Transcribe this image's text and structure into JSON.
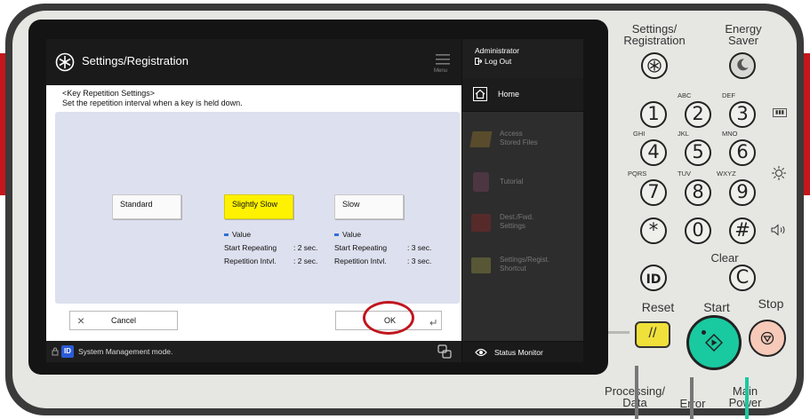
{
  "screen": {
    "title": "Settings/Registration",
    "menu_label": "Menu",
    "heading_line1": "<Key Repetition Settings>",
    "heading_line2": "Set the repetition interval when a key is held down.",
    "options": [
      {
        "label": "Standard",
        "selected": false
      },
      {
        "label": "Slightly Slow",
        "selected": true
      },
      {
        "label": "Slow",
        "selected": false
      }
    ],
    "value_blocks": [
      {
        "heading": "Value",
        "start_label": "Start Repeating",
        "start_value": ": 2  sec.",
        "interval_label": "Repetition Intvl.",
        "interval_value": ": 2  sec."
      },
      {
        "heading": "Value",
        "start_label": "Start Repeating",
        "start_value": ": 3  sec.",
        "interval_label": "Repetition Intvl.",
        "interval_value": ": 3  sec."
      }
    ],
    "cancel_label": "Cancel",
    "ok_label": "OK",
    "status_text": "System Management mode."
  },
  "side_panel": {
    "user": "Administrator",
    "logout": "Log Out",
    "home": "Home",
    "items": [
      {
        "line1": "Access",
        "line2": "Stored Files"
      },
      {
        "line1": "Tutorial",
        "line2": ""
      },
      {
        "line1": "Dest./Fwd.",
        "line2": "Settings"
      },
      {
        "line1": "Settings/Regist.",
        "line2": "Shortcut"
      }
    ],
    "status_monitor": "Status Monitor"
  },
  "keypad": {
    "settings_line1": "Settings/",
    "settings_line2": "Registration",
    "energy_line1": "Energy",
    "energy_line2": "Saver",
    "keys": [
      "1",
      "2",
      "3",
      "4",
      "5",
      "6",
      "7",
      "8",
      "9",
      "*",
      "0",
      "#"
    ],
    "letters": [
      "ABC",
      "DEF",
      "GHI",
      "JKL",
      "MNO",
      "PQRS",
      "TUV",
      "WXYZ"
    ],
    "clear_label": "Clear",
    "clear_key": "C",
    "id_key": "ID",
    "reset_label": "Reset",
    "start_label": "Start",
    "stop_label": "Stop",
    "processing_line1": "Processing/",
    "processing_line2": "Data",
    "error_label": "Error",
    "main_line1": "Main",
    "main_line2": "Power"
  },
  "colors": {
    "accent_red": "#c4161c",
    "selected_yellow": "#fff200",
    "start_green": "#19c9a0",
    "reset_yellow": "#f0e03a"
  }
}
